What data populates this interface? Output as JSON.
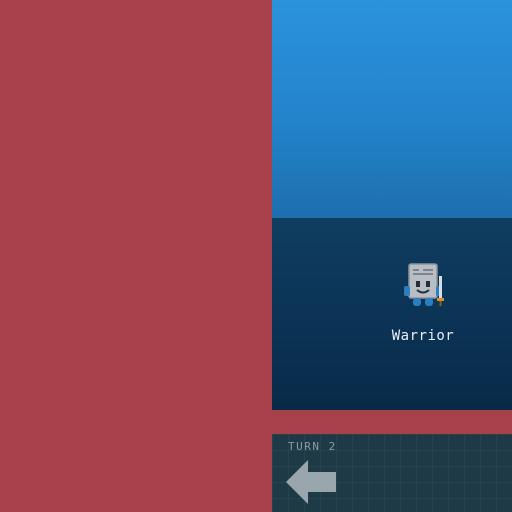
{
  "unit": {
    "name": "Warrior",
    "icon": "warrior-icon"
  },
  "turn_panel": {
    "turn_label": "TURN 2",
    "back_icon": "left-arrow-icon"
  },
  "colors": {
    "background": "#a8414b",
    "sky": "#2383cb",
    "water": "#0b3254",
    "panel": "#1f3a47",
    "arrow": "#9aa6ad"
  }
}
